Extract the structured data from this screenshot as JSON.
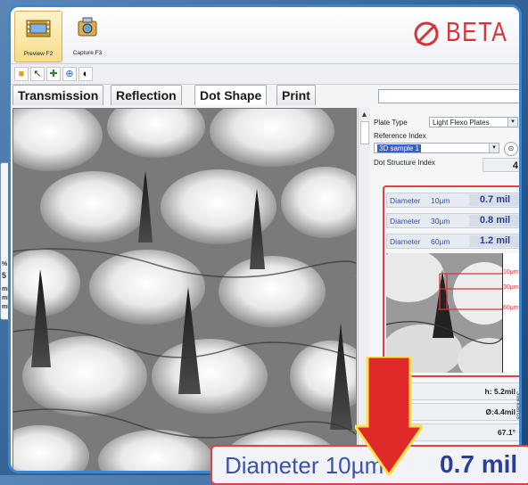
{
  "brand": {
    "name": "BETA",
    "color": "#d6343a"
  },
  "ribbon": {
    "preview_label": "Preview F2",
    "capture_label": "Capture F3"
  },
  "toolbar": {
    "icons": [
      "open-icon",
      "cursor-icon",
      "measure-icon",
      "zoom-icon",
      "contrast-icon"
    ]
  },
  "tabs": [
    {
      "label": "Transmission"
    },
    {
      "label": "Reflection"
    },
    {
      "label": "Dot Shape"
    },
    {
      "label": "Print"
    }
  ],
  "side": {
    "plate_type_label": "Plate Type",
    "plate_type_value": "Light Flexo Plates",
    "reference_index_label": "Reference Index",
    "reference_value": "3D sample 1",
    "dot_structure_label": "Dot Structure Index",
    "dot_structure_value": "4",
    "diameters": [
      {
        "label": "Diameter",
        "depth": "10µm",
        "value": "0.7 mil"
      },
      {
        "label": "Diameter",
        "depth": "30µm",
        "value": "0.8 mil"
      },
      {
        "label": "Diameter",
        "depth": "60µm",
        "value": "1.2 mil"
      }
    ],
    "profile_levels": [
      "10µm",
      "30µm",
      "60µm"
    ],
    "measurements": [
      "h: 5.2mil",
      "Ø:4.4mil",
      "67.1°"
    ],
    "vertical_tab": "Standards"
  },
  "callout": {
    "text": "Diameter  10µm",
    "value": "0.7 mil"
  },
  "background_panel": {
    "lines": [
      "%",
      "5",
      "mil",
      "mil",
      "mil"
    ]
  },
  "colors": {
    "accent_red": "#e73d44",
    "window_border": "#3d86cf",
    "value_blue": "#2c3f98"
  }
}
